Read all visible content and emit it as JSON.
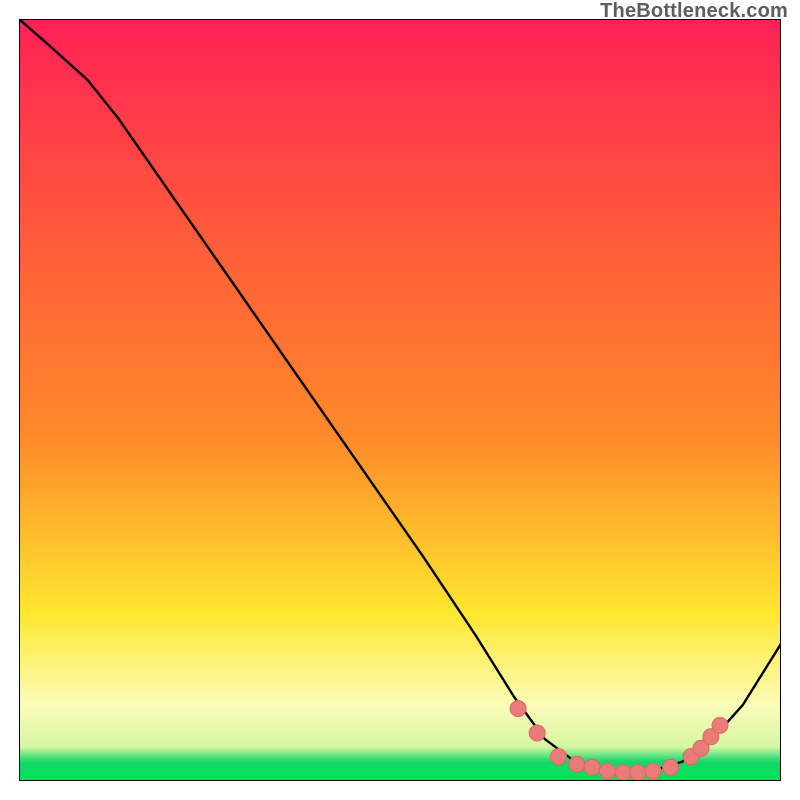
{
  "attribution": "TheBottleneck.com",
  "colors": {
    "top_red": "#ff2057",
    "mid_orange": "#ff8a2a",
    "yellow": "#ffe72e",
    "pale_yellow": "#fbfcb8",
    "green_band": "#14d76a",
    "bright_green": "#00e454",
    "curve_stroke": "#000000",
    "dot_fill": "#e97c79",
    "dot_stroke": "#da6761",
    "frame_stroke": "#000000"
  },
  "chart_data": {
    "type": "line",
    "title": "",
    "xlabel": "",
    "ylabel": "",
    "xlim": [
      0,
      1
    ],
    "ylim": [
      0,
      1
    ],
    "note_axes": "No ticks or axis labels are visible; x and y are normalized to the plot area (0..1 from left/bottom to right/top).",
    "curve": [
      {
        "x": 0.0,
        "y": 1.0
      },
      {
        "x": 0.04,
        "y": 0.965
      },
      {
        "x": 0.09,
        "y": 0.92
      },
      {
        "x": 0.13,
        "y": 0.87
      },
      {
        "x": 0.21,
        "y": 0.755
      },
      {
        "x": 0.29,
        "y": 0.64
      },
      {
        "x": 0.37,
        "y": 0.525
      },
      {
        "x": 0.45,
        "y": 0.41
      },
      {
        "x": 0.53,
        "y": 0.295
      },
      {
        "x": 0.6,
        "y": 0.19
      },
      {
        "x": 0.65,
        "y": 0.11
      },
      {
        "x": 0.69,
        "y": 0.055
      },
      {
        "x": 0.73,
        "y": 0.025
      },
      {
        "x": 0.77,
        "y": 0.012
      },
      {
        "x": 0.82,
        "y": 0.01
      },
      {
        "x": 0.87,
        "y": 0.025
      },
      {
        "x": 0.91,
        "y": 0.055
      },
      {
        "x": 0.95,
        "y": 0.1
      },
      {
        "x": 1.0,
        "y": 0.18
      }
    ],
    "dots": [
      {
        "x": 0.655,
        "y": 0.095
      },
      {
        "x": 0.68,
        "y": 0.063
      },
      {
        "x": 0.708,
        "y": 0.032
      },
      {
        "x": 0.732,
        "y": 0.022
      },
      {
        "x": 0.752,
        "y": 0.018
      },
      {
        "x": 0.772,
        "y": 0.013
      },
      {
        "x": 0.793,
        "y": 0.011
      },
      {
        "x": 0.812,
        "y": 0.011
      },
      {
        "x": 0.832,
        "y": 0.013
      },
      {
        "x": 0.855,
        "y": 0.018
      },
      {
        "x": 0.882,
        "y": 0.032
      },
      {
        "x": 0.895,
        "y": 0.043
      },
      {
        "x": 0.908,
        "y": 0.058
      },
      {
        "x": 0.92,
        "y": 0.073
      }
    ],
    "dot_radius_px": 8
  }
}
